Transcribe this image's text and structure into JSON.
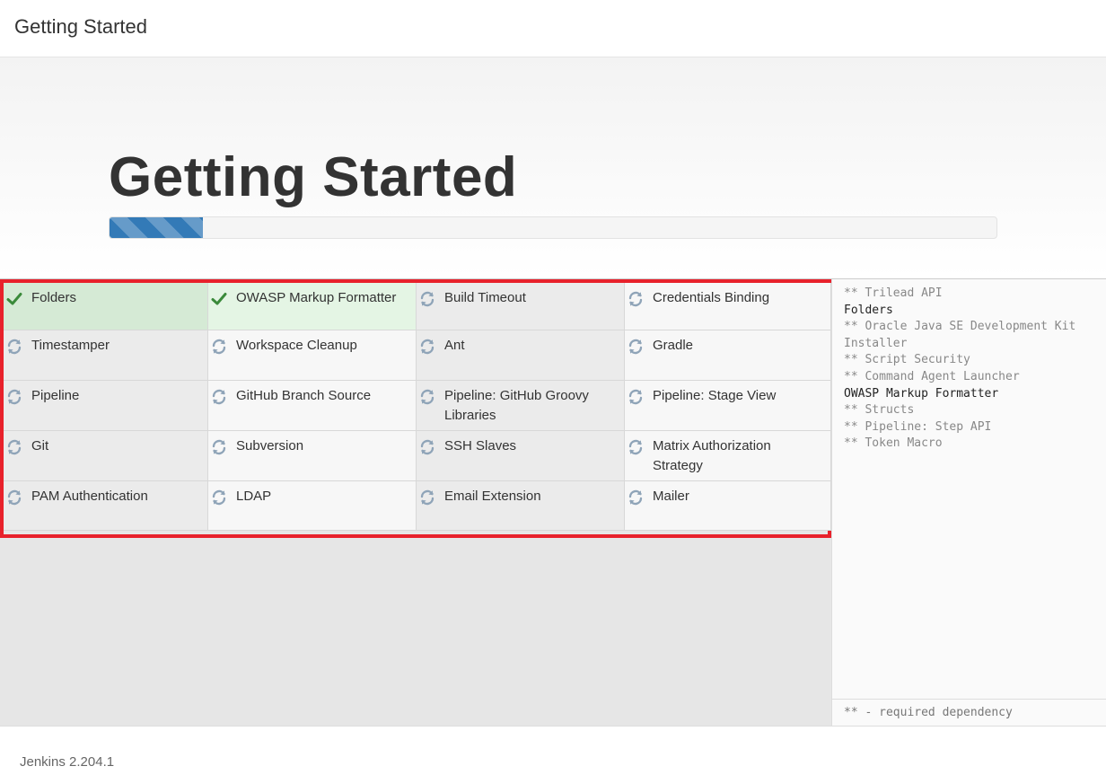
{
  "header": {
    "title": "Getting Started"
  },
  "hero": {
    "heading": "Getting Started",
    "progress_fraction": 0.105
  },
  "plugins": [
    {
      "name": "Folders",
      "status": "installed",
      "icon": "check-icon"
    },
    {
      "name": "OWASP Markup Formatter",
      "status": "installed",
      "icon": "check-icon"
    },
    {
      "name": "Build Timeout",
      "status": "pending",
      "icon": "refresh-icon"
    },
    {
      "name": "Credentials Binding",
      "status": "pending",
      "icon": "refresh-icon"
    },
    {
      "name": "Timestamper",
      "status": "pending",
      "icon": "refresh-icon"
    },
    {
      "name": "Workspace Cleanup",
      "status": "pending",
      "icon": "refresh-icon"
    },
    {
      "name": "Ant",
      "status": "pending",
      "icon": "refresh-icon"
    },
    {
      "name": "Gradle",
      "status": "pending",
      "icon": "refresh-icon"
    },
    {
      "name": "Pipeline",
      "status": "pending",
      "icon": "refresh-icon"
    },
    {
      "name": "GitHub Branch Source",
      "status": "pending",
      "icon": "refresh-icon"
    },
    {
      "name": "Pipeline: GitHub Groovy Libraries",
      "status": "pending",
      "icon": "refresh-icon"
    },
    {
      "name": "Pipeline: Stage View",
      "status": "pending",
      "icon": "refresh-icon"
    },
    {
      "name": "Git",
      "status": "pending",
      "icon": "refresh-icon"
    },
    {
      "name": "Subversion",
      "status": "pending",
      "icon": "refresh-icon"
    },
    {
      "name": "SSH Slaves",
      "status": "pending",
      "icon": "refresh-icon"
    },
    {
      "name": "Matrix Authorization Strategy",
      "status": "pending",
      "icon": "refresh-icon"
    },
    {
      "name": "PAM Authentication",
      "status": "pending",
      "icon": "refresh-icon"
    },
    {
      "name": "LDAP",
      "status": "pending",
      "icon": "refresh-icon"
    },
    {
      "name": "Email Extension",
      "status": "pending",
      "icon": "refresh-icon"
    },
    {
      "name": "Mailer",
      "status": "pending",
      "icon": "refresh-icon"
    }
  ],
  "log": [
    {
      "text": "** Trilead API",
      "dependency": true
    },
    {
      "text": "Folders",
      "dependency": false
    },
    {
      "text": "** Oracle Java SE Development Kit Installer",
      "dependency": true
    },
    {
      "text": "** Script Security",
      "dependency": true
    },
    {
      "text": "** Command Agent Launcher",
      "dependency": true
    },
    {
      "text": "OWASP Markup Formatter",
      "dependency": false
    },
    {
      "text": "** Structs",
      "dependency": true
    },
    {
      "text": "** Pipeline: Step API",
      "dependency": true
    },
    {
      "text": "** Token Macro",
      "dependency": true
    }
  ],
  "legend": "** - required dependency",
  "footer": {
    "version": "Jenkins 2.204.1"
  },
  "colors": {
    "installed_check": "#3a8a3a",
    "pending_icon": "#8fa4b8",
    "progress": "#337ab7",
    "highlight_border": "#e8212b"
  }
}
